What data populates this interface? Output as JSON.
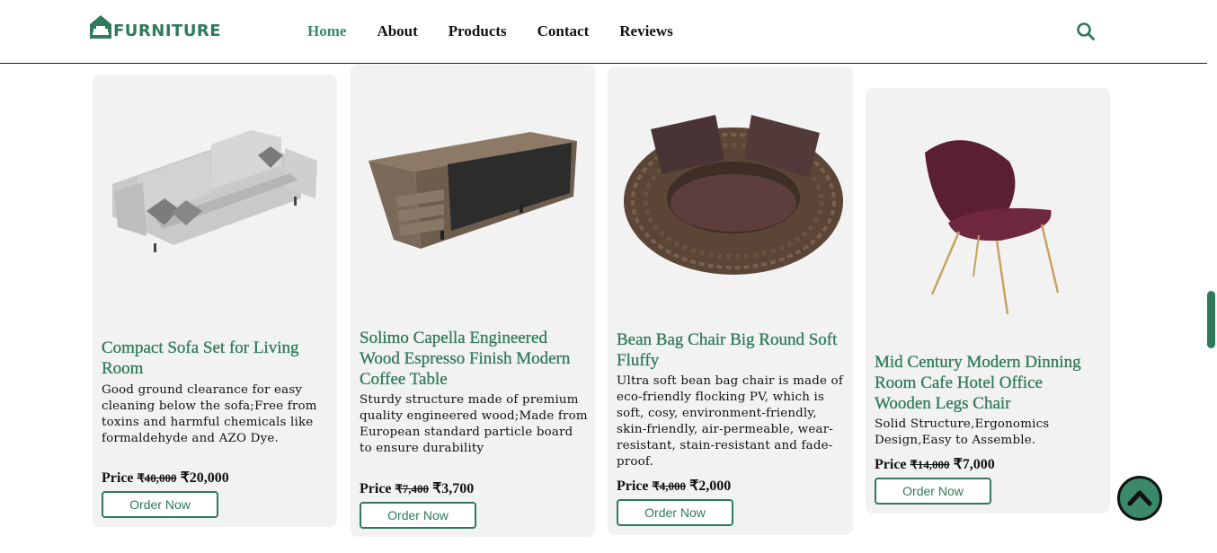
{
  "header": {
    "logo_text": "FURNITURE",
    "nav": [
      "Home",
      "About",
      "Products",
      "Contact",
      "Reviews"
    ],
    "active_nav": "Home"
  },
  "colors": {
    "brand": "#2f7a5a",
    "card_bg": "#f2f2f2",
    "nav_active": "#3a8a6a"
  },
  "icons": {
    "logo": "house-logo-icon",
    "search": "search-icon",
    "scroll_top": "chevron-up-icon"
  },
  "products": [
    {
      "title": "Compact Sofa Set for Living Room",
      "description": "Good ground clearance for easy cleaning below the sofa;Free from toxins and harmful chemicals like formaldehyde and AZO Dye.",
      "price_label": "Price",
      "old_price": "₹40,000",
      "new_price": "₹20,000",
      "button": "Order Now",
      "image": "grey-sofa"
    },
    {
      "title": "Solimo Capella Engineered Wood Espresso Finish Modern Coffee Table",
      "description": "Sturdy structure made of premium quality engineered wood;Made from European standard particle board to ensure durability",
      "price_label": "Price",
      "old_price": "₹7,400",
      "new_price": "₹3,700",
      "button": "Order Now",
      "image": "wood-coffee-table"
    },
    {
      "title": "Bean Bag Chair Big Round Soft Fluffy",
      "description": "Ultra soft bean bag chair is made of eco-friendly flocking PV, which is soft, cosy, environment-friendly, skin-friendly, air-permeable, wear-resistant, stain-resistant and fade-proof.",
      "price_label": "Price",
      "old_price": "₹4,000",
      "new_price": "₹2,000",
      "button": "Order Now",
      "image": "wicker-round-chair"
    },
    {
      "title": "Mid Century Modern Dinning Room Cafe Hotel Office Wooden Legs Chair",
      "description": "Solid Structure,Ergonomics Design,Easy to Assemble.",
      "price_label": "Price",
      "old_price": "₹14,000",
      "new_price": "₹7,000",
      "button": "Order Now",
      "image": "velvet-chair"
    }
  ]
}
